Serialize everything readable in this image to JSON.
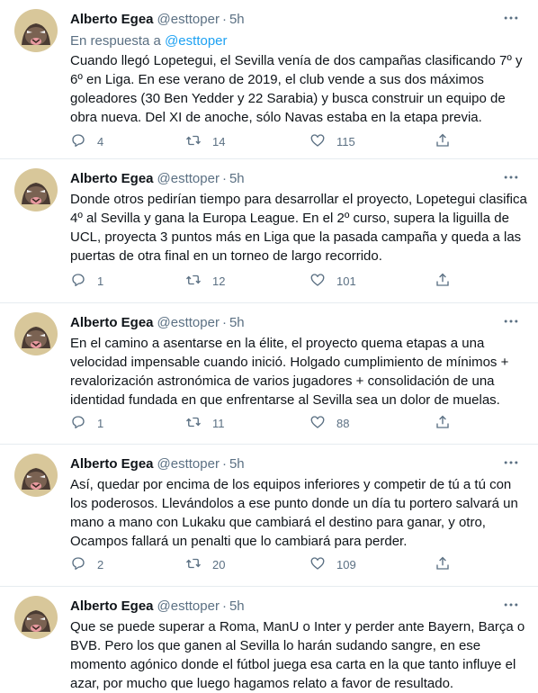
{
  "tweets": [
    {
      "name": "Alberto Egea",
      "handle": "@esttoper",
      "time": "5h",
      "reply_prefix": "En respuesta a",
      "reply_mention": "@esttoper",
      "text": "Cuando llegó Lopetegui, el Sevilla venía de dos campañas clasificando 7º y 6º en Liga. En ese verano de 2019, el club vende a sus dos máximos goleadores (30 Ben Yedder y 22 Sarabia) y busca construir un equipo de obra nueva. Del XI de anoche, sólo Navas estaba en la etapa previa.",
      "replies": "4",
      "retweets": "14",
      "likes": "115"
    },
    {
      "name": "Alberto Egea",
      "handle": "@esttoper",
      "time": "5h",
      "text": "Donde otros pedirían tiempo para desarrollar el proyecto, Lopetegui clasifica 4º al Sevilla y gana la Europa League. En el 2º curso, supera la liguilla de UCL, proyecta 3 puntos más en Liga que la pasada campaña y queda a las puertas de otra final en un torneo de largo recorrido.",
      "replies": "1",
      "retweets": "12",
      "likes": "101"
    },
    {
      "name": "Alberto Egea",
      "handle": "@esttoper",
      "time": "5h",
      "text": "En el camino a asentarse en la élite, el proyecto quema etapas a una velocidad impensable cuando inició. Holgado cumplimiento de mínimos + revalorización astronómica de varios jugadores + consolidación de una identidad fundada en que enfrentarse al Sevilla sea un dolor de muelas.",
      "replies": "1",
      "retweets": "11",
      "likes": "88"
    },
    {
      "name": "Alberto Egea",
      "handle": "@esttoper",
      "time": "5h",
      "text": "Así, quedar por encima de los equipos inferiores y competir de tú a tú con los poderosos. Llevándolos a ese punto donde un día tu portero salvará un mano a mano con Lukaku que cambiará el destino para ganar, y otro, Ocampos fallará un penalti que lo cambiará para perder.",
      "replies": "2",
      "retweets": "20",
      "likes": "109"
    },
    {
      "name": "Alberto Egea",
      "handle": "@esttoper",
      "time": "5h",
      "text": "Que se puede superar a Roma, ManU o Inter y perder ante Bayern, Barça o BVB. Pero los que ganen al Sevilla lo harán sudando sangre, en ese momento agónico donde el fútbol juega esa carta en la que tanto influye el azar, por mucho que luego hagamos relato a favor de resultado."
    }
  ],
  "icons": {
    "reply": "reply-icon",
    "retweet": "retweet-icon",
    "like": "like-icon",
    "share": "share-icon",
    "more": "more-icon"
  },
  "colors": {
    "secondary_text": "#5b7083",
    "link": "#1da1f2",
    "divider": "#e6ecf0"
  }
}
